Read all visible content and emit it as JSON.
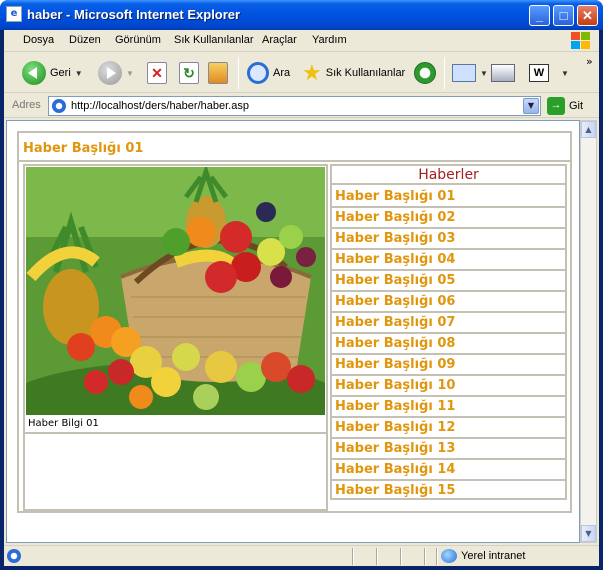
{
  "window": {
    "title": "haber - Microsoft Internet Explorer",
    "controls": {
      "minimize": "_",
      "maximize": "□",
      "close": "✕"
    }
  },
  "menubar": {
    "items": [
      "Dosya",
      "Düzen",
      "Görünüm",
      "Sık Kullanılanlar",
      "Araçlar",
      "Yardım"
    ]
  },
  "toolbar": {
    "back_label": "Geri",
    "search_label": "Ara",
    "favorites_label": "Sık Kullanılanlar",
    "overflow": "»"
  },
  "addressbar": {
    "label": "Adres",
    "url": "http://localhost/ders/haber/haber.asp",
    "go_label": "Git"
  },
  "page": {
    "heading": "Haber Başlığı 01",
    "photo_caption": "Haber Bilgi 01",
    "news_list_title": "Haberler",
    "news_items": [
      "Haber Başlığı 01",
      "Haber Başlığı 02",
      "Haber Başlığı 03",
      "Haber Başlığı 04",
      "Haber Başlığı 05",
      "Haber Başlığı 06",
      "Haber Başlığı 07",
      "Haber Başlığı 08",
      "Haber Başlığı 09",
      "Haber Başlığı 10",
      "Haber Başlığı 11",
      "Haber Başlığı 12",
      "Haber Başlığı 13",
      "Haber Başlığı 14",
      "Haber Başlığı 15"
    ],
    "colors": {
      "heading": "#e0960e",
      "list_title": "#a52020",
      "border": "#c4c0b4"
    }
  },
  "statusbar": {
    "zone": "Yerel intranet"
  }
}
